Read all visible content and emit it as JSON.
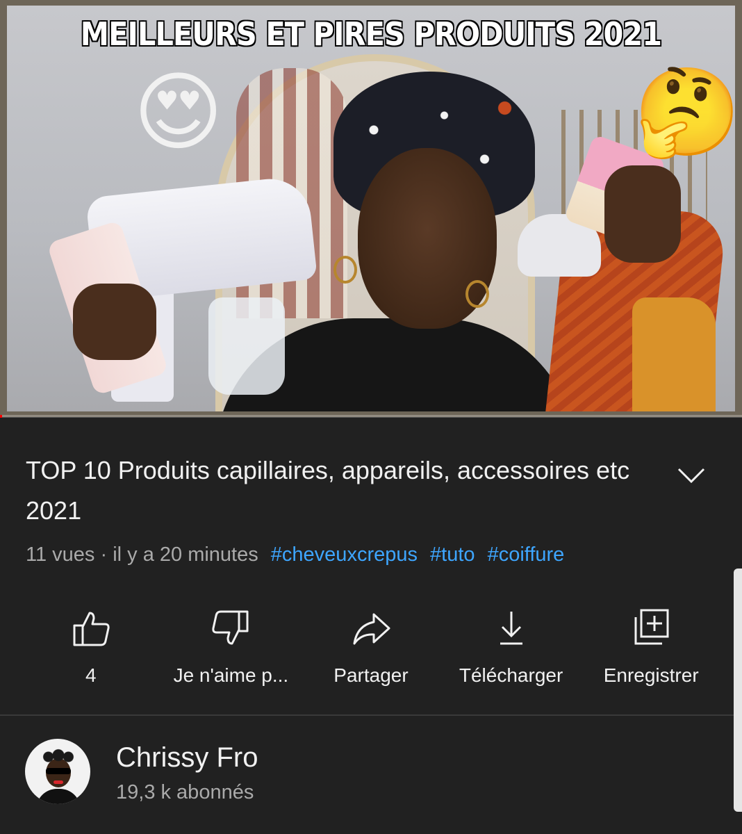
{
  "thumbnail": {
    "banner_text": "MEILLEURS ET PIRES PRODUITS 2021",
    "emoji_left": "😍",
    "emoji_right": "🤔",
    "progress_fraction": 0.003,
    "colors": {
      "progress": "#ff0000",
      "background": "#212121"
    }
  },
  "video": {
    "title": "TOP 10 Produits capillaires, appareils, accessoires etc 2021",
    "views_time": "11 vues · il y a 20 minutes",
    "hashtags": [
      "#cheveuxcrepus",
      "#tuto",
      "#coiffure"
    ],
    "expand_icon": "chevron-down-icon",
    "colors": {
      "hashtag": "#3ea6ff",
      "secondary_text": "#aaaaaa"
    }
  },
  "actions": {
    "like": {
      "label": "4",
      "icon": "thumbs-up-icon"
    },
    "dislike": {
      "label": "Je n'aime p...",
      "icon": "thumbs-down-icon"
    },
    "share": {
      "label": "Partager",
      "icon": "share-icon"
    },
    "download": {
      "label": "Télécharger",
      "icon": "download-icon"
    },
    "save": {
      "label": "Enregistrer",
      "icon": "playlist-add-icon"
    }
  },
  "channel": {
    "name": "Chrissy Fro",
    "subscribers": "19,3 k abonnés"
  }
}
